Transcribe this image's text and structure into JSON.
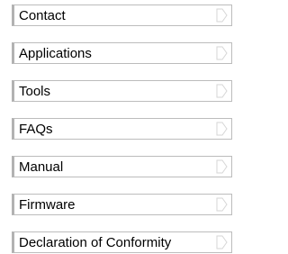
{
  "menu": {
    "items": [
      {
        "label": "Contact",
        "icon": "chevron-right-icon"
      },
      {
        "label": "Applications",
        "icon": "chevron-right-icon"
      },
      {
        "label": "Tools",
        "icon": "chevron-right-icon"
      },
      {
        "label": "FAQs",
        "icon": "chevron-right-icon"
      },
      {
        "label": "Manual",
        "icon": "chevron-right-icon"
      },
      {
        "label": "Firmware",
        "icon": "chevron-right-icon"
      },
      {
        "label": "Declaration of Conformity",
        "icon": "chevron-right-icon"
      }
    ]
  },
  "colors": {
    "border": "#bcbcbc",
    "accent_border": "#b2b2b2",
    "icon": "#d6d6d6",
    "text": "#000000"
  }
}
